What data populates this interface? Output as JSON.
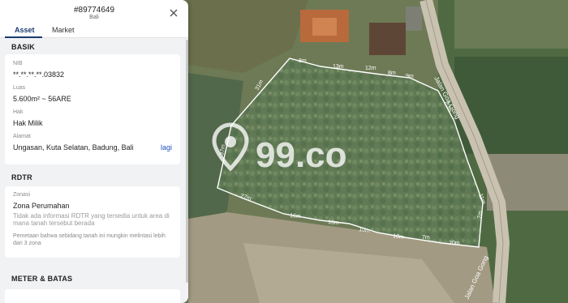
{
  "header": {
    "id": "#89774649",
    "location": "Bali"
  },
  "tabs": [
    {
      "label": "Asset"
    },
    {
      "label": "Market"
    }
  ],
  "basik": {
    "title": "BASIK",
    "nib_label": "NIB",
    "nib_value": "**.**.**.**.03832",
    "luas_label": "Luas",
    "luas_value": "5.600m² ~ 56ARE",
    "hak_label": "Hak",
    "hak_value": "Hak Milik",
    "alamat_label": "Alamat",
    "alamat_value": "Ungasan, Kuta Selatan, Badung, Bali",
    "alamat_link": "lagi"
  },
  "rdtr": {
    "title": "RDTR",
    "zonasi_label": "Zonasi",
    "zonasi_value": "Zona Perumahan",
    "info": "Tidak ada informasi RDTR yang tersedia untuk area di mana tanah tersebut berada",
    "warning": "Pemetaan bahwa sebidang tanah ini mungkin melintasi lebih dari 3 zona"
  },
  "meter": {
    "title": "METER & BATAS"
  },
  "map": {
    "watermark": "99.co",
    "street_name": "Jalan Goa Gong",
    "dimension_labels": [
      "8m",
      "13m",
      "12m",
      "8m",
      "9m",
      "31m",
      "37m",
      "20m",
      "27m",
      "16m",
      "16m",
      "10m",
      "18m",
      "7m",
      "20m",
      "11m",
      "7m"
    ]
  }
}
